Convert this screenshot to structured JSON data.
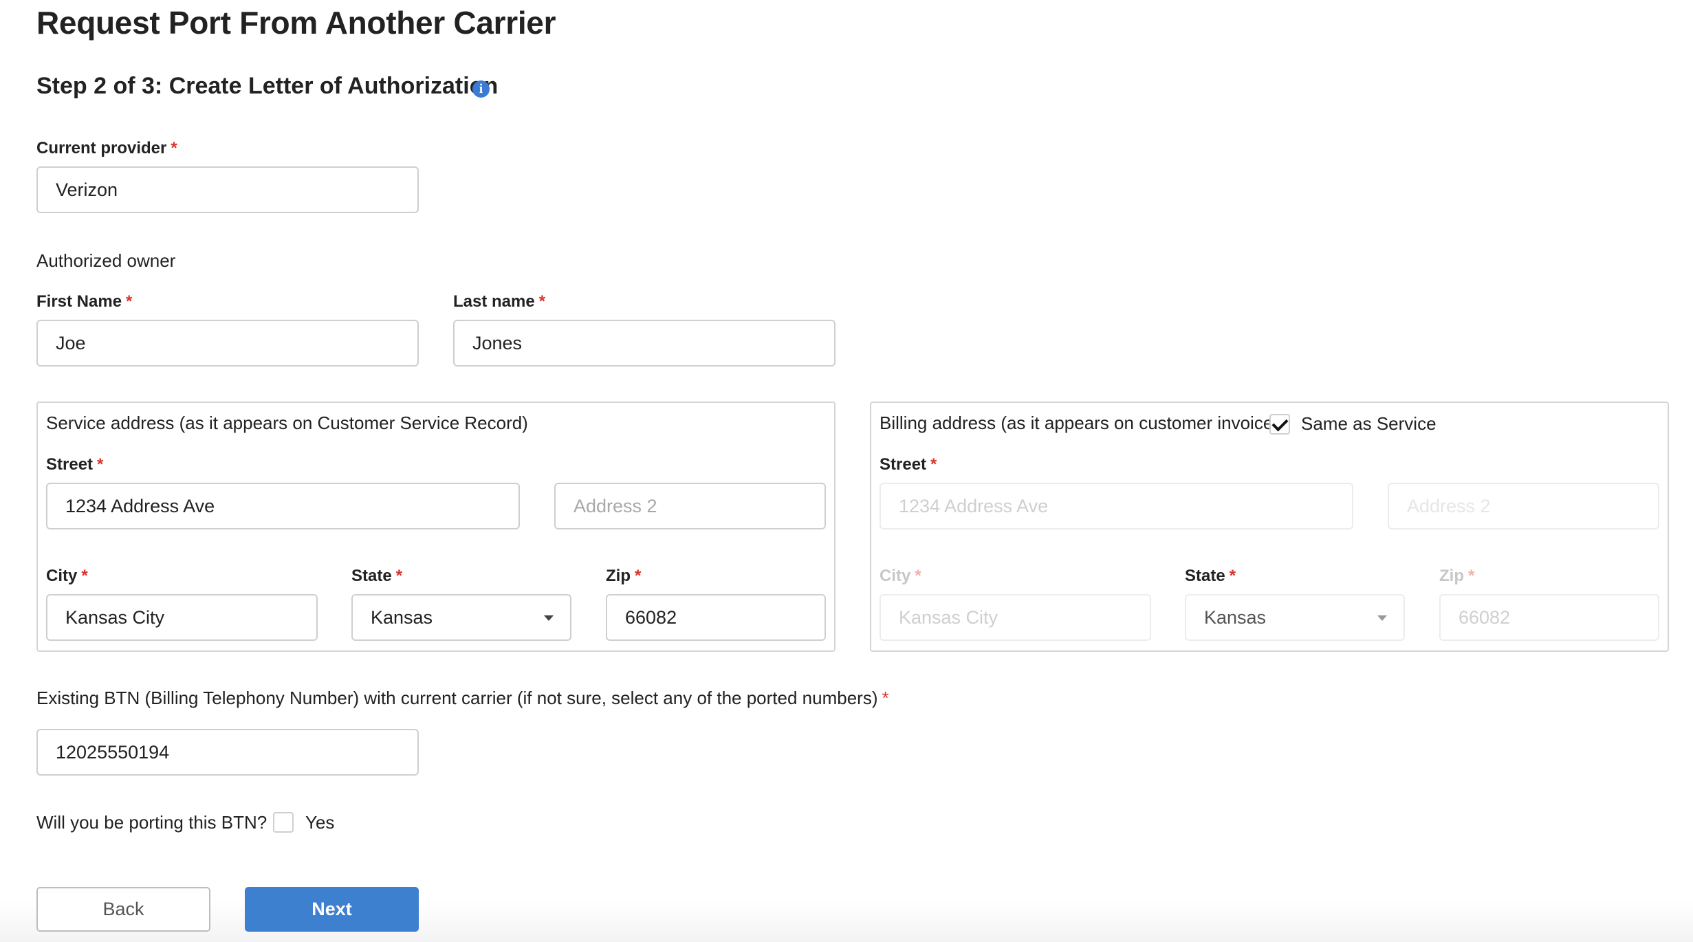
{
  "page": {
    "title": "Request Port From Another Carrier",
    "step_title": "Step 2 of 3: Create Letter of Authorization"
  },
  "current_provider": {
    "label": "Current provider",
    "required_mark": "*",
    "value": "Verizon"
  },
  "authorized_owner": {
    "heading": "Authorized owner",
    "first_name": {
      "label": "First Name",
      "required_mark": "*",
      "value": "Joe"
    },
    "last_name": {
      "label": "Last name",
      "required_mark": "*",
      "value": "Jones"
    }
  },
  "service_address": {
    "legend": "Service address (as it appears on Customer Service Record)",
    "street": {
      "label": "Street",
      "required_mark": "*",
      "value": "1234 Address Ave"
    },
    "address2": {
      "placeholder": "Address 2"
    },
    "city": {
      "label": "City",
      "required_mark": "*",
      "value": "Kansas City"
    },
    "state": {
      "label": "State",
      "required_mark": "*",
      "value": "Kansas"
    },
    "zip": {
      "label": "Zip",
      "required_mark": "*",
      "value": "66082"
    }
  },
  "billing_address": {
    "legend": "Billing address (as it appears on customer invoice)",
    "same_as_service": {
      "label": "Same as Service",
      "checked": true
    },
    "street": {
      "label": "Street",
      "required_mark": "*",
      "value": "1234 Address Ave"
    },
    "address2": {
      "placeholder": "Address 2"
    },
    "city": {
      "label": "City",
      "required_mark": "*",
      "value": "Kansas City"
    },
    "state": {
      "label": "State",
      "required_mark": "*",
      "value": "Kansas"
    },
    "zip": {
      "label": "Zip",
      "required_mark": "*",
      "value": "66082"
    }
  },
  "btn": {
    "label": "Existing BTN (Billing Telephony Number) with current carrier (if not sure, select any of the ported numbers)",
    "required_mark": "*",
    "value": "12025550194"
  },
  "porting_btn": {
    "question": "Will you be porting this BTN?",
    "option_label": "Yes",
    "checked": false
  },
  "actions": {
    "back_label": "Back",
    "next_label": "Next"
  },
  "icons": {
    "info": "info-icon",
    "dropdown": "chevron-down-icon",
    "check": "checkmark-icon"
  },
  "colors": {
    "accent": "#3d80cf",
    "required": "#d9342b",
    "border": "#cfcfcf"
  }
}
